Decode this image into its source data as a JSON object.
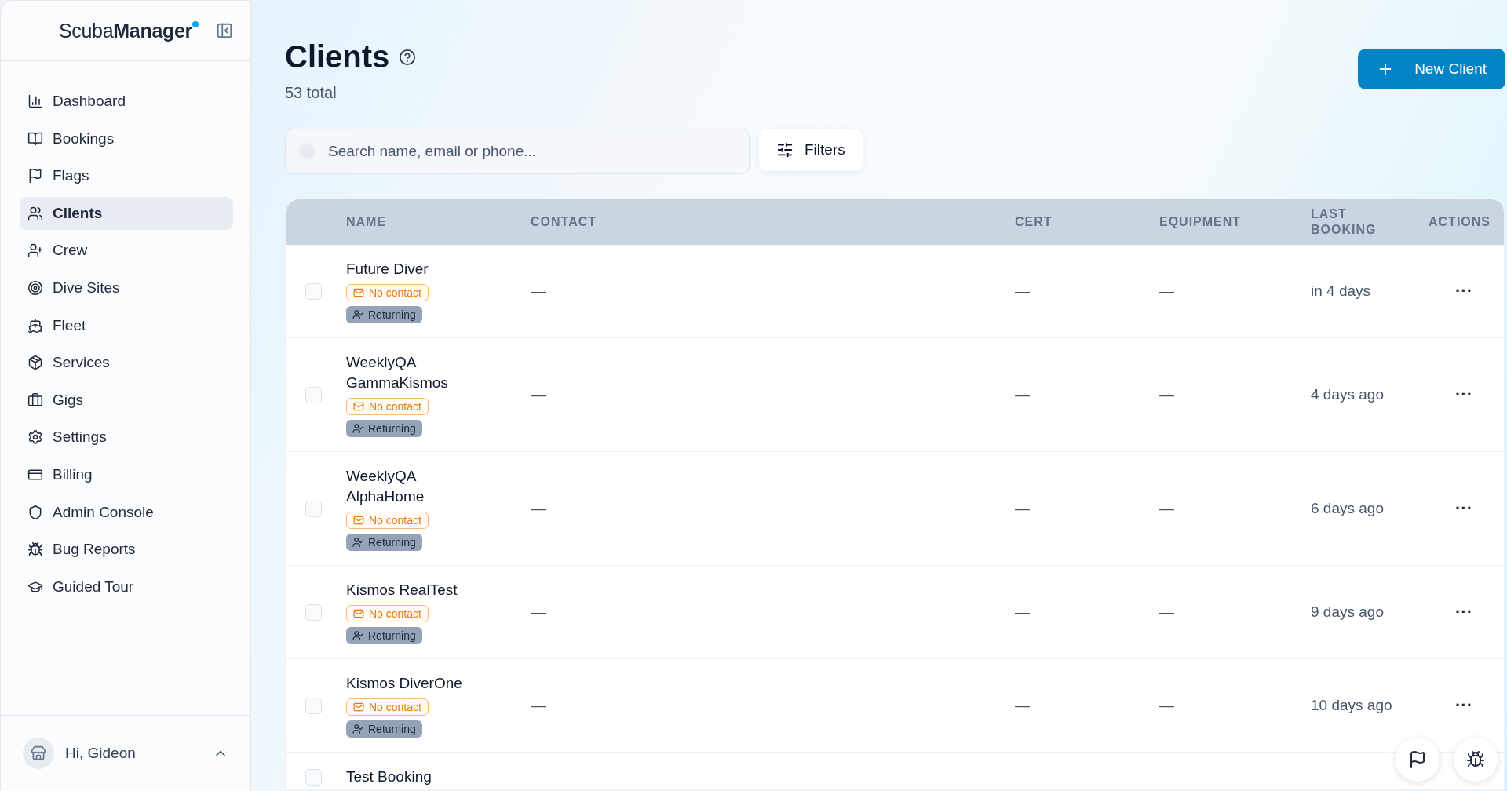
{
  "sidebar": {
    "brand_light": "Scuba",
    "brand_bold": "Manager",
    "items": [
      {
        "label": "Dashboard",
        "selected": false
      },
      {
        "label": "Bookings",
        "selected": false
      },
      {
        "label": "Flags",
        "selected": false
      },
      {
        "label": "Clients",
        "selected": true
      },
      {
        "label": "Crew",
        "selected": false
      },
      {
        "label": "Dive Sites",
        "selected": false
      },
      {
        "label": "Fleet",
        "selected": false
      },
      {
        "label": "Services",
        "selected": false
      },
      {
        "label": "Gigs",
        "selected": false
      },
      {
        "label": "Settings",
        "selected": false
      },
      {
        "label": "Billing",
        "selected": false
      },
      {
        "label": "Admin Console",
        "selected": false
      },
      {
        "label": "Bug Reports",
        "selected": false
      },
      {
        "label": "Guided Tour",
        "selected": false
      }
    ],
    "user": "Hi, Gideon"
  },
  "header": {
    "title": "Clients",
    "subtitle": "53 total",
    "new_button": "New Client"
  },
  "search": {
    "placeholder": "Search name, email or phone..."
  },
  "filters_button": "Filters",
  "table": {
    "columns": [
      "NAME",
      "CONTACT",
      "CERT",
      "EQUIPMENT",
      "LAST BOOKING",
      "ACTIONS"
    ],
    "rows": [
      {
        "checked": false,
        "name": "Future Diver",
        "contact_badge": "No contact",
        "status_badge": "Returning",
        "contact": "—",
        "cert": "—",
        "equipment": "—",
        "last_booking": "in 4 days",
        "actions": "···"
      },
      {
        "checked": false,
        "name": "WeeklyQA GammaKismos",
        "contact_badge": "No contact",
        "status_badge": "Returning",
        "contact": "—",
        "cert": "—",
        "equipment": "—",
        "last_booking": "4 days ago",
        "actions": "···"
      },
      {
        "checked": false,
        "name": "WeeklyQA AlphaHome",
        "contact_badge": "No contact",
        "status_badge": "Returning",
        "contact": "—",
        "cert": "—",
        "equipment": "—",
        "last_booking": "6 days ago",
        "actions": "···"
      },
      {
        "checked": false,
        "name": "Kismos RealTest",
        "contact_badge": "No contact",
        "status_badge": "Returning",
        "contact": "—",
        "cert": "—",
        "equipment": "—",
        "last_booking": "9 days ago",
        "actions": "···"
      },
      {
        "checked": false,
        "name": "Kismos DiverOne",
        "contact_badge": "No contact",
        "status_badge": "Returning",
        "contact": "—",
        "cert": "—",
        "equipment": "—",
        "last_booking": "10 days ago",
        "actions": "···"
      },
      {
        "checked": false,
        "name": "Test Booking"
      }
    ]
  }
}
